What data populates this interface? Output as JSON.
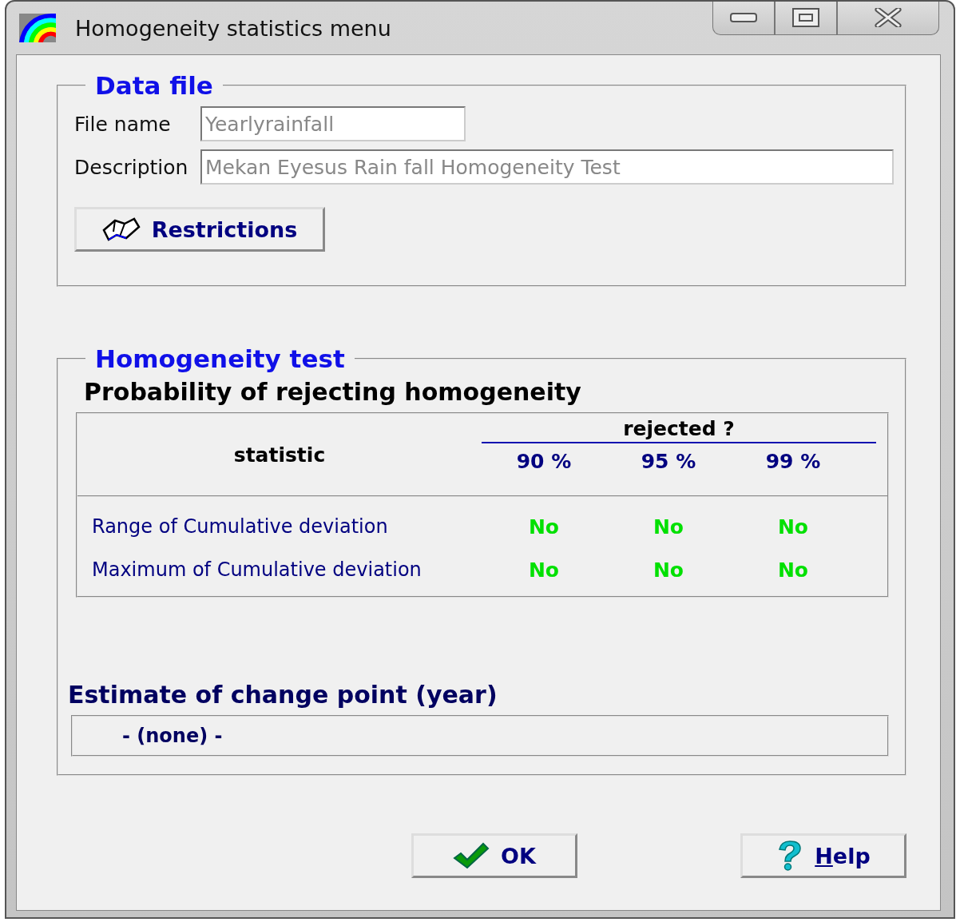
{
  "window": {
    "title": "Homogeneity statistics menu"
  },
  "data_file": {
    "title": "Data file",
    "fields": [
      {
        "label": "File name",
        "value": "Yearlyrainfall",
        "disabled": true
      },
      {
        "label": "Description",
        "value": "Mekan Eyesus Rain fall Homogeneity Test",
        "disabled": true
      }
    ],
    "restrictions_button": "Restrictions"
  },
  "homogeneity_test": {
    "title": "Homogeneity test",
    "subtitle": "Probability of rejecting homogeneity",
    "table": {
      "statistic_header": "statistic",
      "group_header": "rejected ?",
      "columns": [
        "90 %",
        "95 %",
        "99 %"
      ],
      "rows": [
        {
          "statistic": "Range of Cumulative deviation",
          "results": [
            "No",
            "No",
            "No"
          ]
        },
        {
          "statistic": "Maximum of Cumulative deviation",
          "results": [
            "No",
            "No",
            "No"
          ]
        }
      ]
    },
    "change_point_label": "Estimate of change point (year)",
    "change_point_value": "- (none) -"
  },
  "buttons": [
    {
      "kind": "ok",
      "label": "OK",
      "access_key_underlined": false
    },
    {
      "kind": "help",
      "label": "Help",
      "access_key_underlined": true
    }
  ]
}
